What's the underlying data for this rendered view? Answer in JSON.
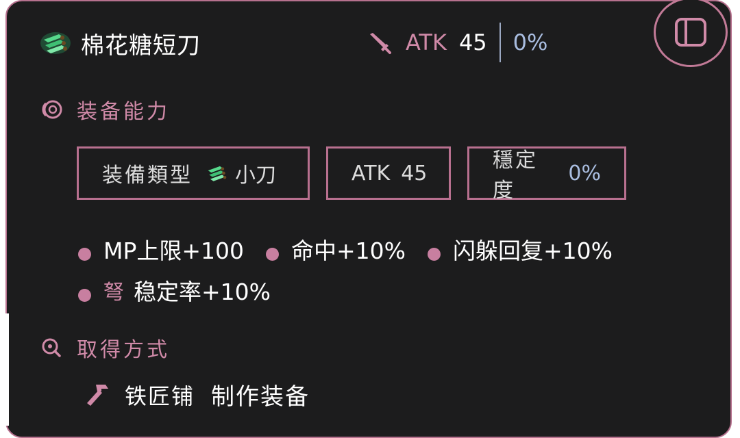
{
  "item": {
    "name": "棉花糖短刀",
    "icon": "green-dagger-icon"
  },
  "top_stats": {
    "atk_label": "ATK",
    "atk_value": "45",
    "stability_value": "0%"
  },
  "equip_section": {
    "title": "装备能力",
    "chips": [
      {
        "label": "装備類型",
        "value": "小刀"
      },
      {
        "label": "ATK",
        "value": "45"
      },
      {
        "label": "穩定度",
        "value": "0%"
      }
    ],
    "bonuses_row1": [
      "MP上限+100",
      "命中+10%",
      "闪躲回复+10%"
    ],
    "bonus_row2": {
      "tag": "弩",
      "text": "稳定率+10%"
    }
  },
  "source_section": {
    "title": "取得方式",
    "place": "铁匠铺",
    "method": "制作装备"
  },
  "colors": {
    "accent": "#b6718e",
    "accent_text": "#d08aa8",
    "background": "#1c1c1d",
    "blue_value": "#a9bde0"
  }
}
